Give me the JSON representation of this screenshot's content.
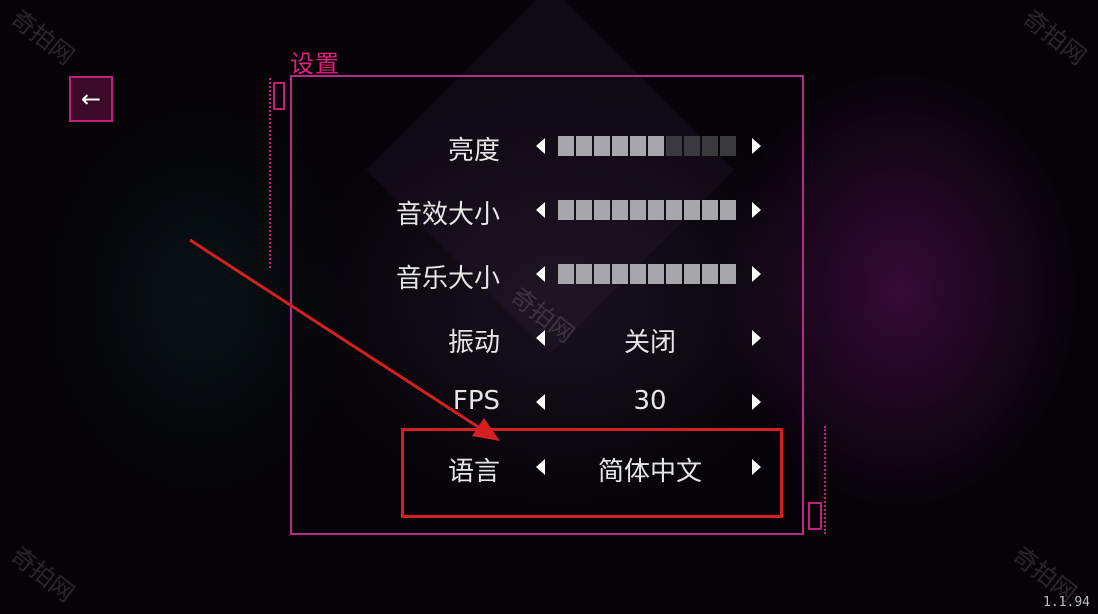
{
  "title": "设置",
  "back_icon": "←",
  "settings": [
    {
      "label": "亮度",
      "type": "slider",
      "level": 6,
      "max": 10
    },
    {
      "label": "音效大小",
      "type": "slider",
      "level": 10,
      "max": 10
    },
    {
      "label": "音乐大小",
      "type": "slider",
      "level": 10,
      "max": 10
    },
    {
      "label": "振动",
      "type": "value",
      "value": "关闭"
    },
    {
      "label": "FPS",
      "type": "value",
      "value": "30"
    },
    {
      "label": "语言",
      "type": "value",
      "value": "简体中文"
    }
  ],
  "version": "1.1.94",
  "watermark": "奇拍网",
  "colors": {
    "accent": "#c0207a",
    "annotation": "#d42020"
  }
}
